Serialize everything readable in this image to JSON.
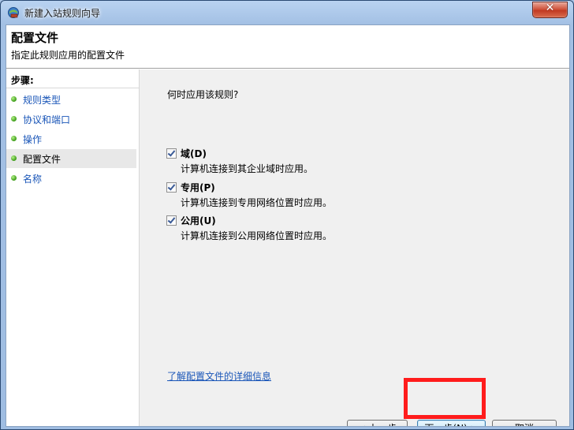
{
  "window": {
    "title": "新建入站规则向导",
    "close_symbol": "✕"
  },
  "header": {
    "title": "配置文件",
    "subtitle": "指定此规则应用的配置文件"
  },
  "sidebar": {
    "steps_label": "步骤:",
    "items": [
      {
        "label": "规则类型"
      },
      {
        "label": "协议和端口"
      },
      {
        "label": "操作"
      },
      {
        "label": "配置文件"
      },
      {
        "label": "名称"
      }
    ]
  },
  "content": {
    "question": "何时应用该规则?",
    "options": [
      {
        "label": "域(D)",
        "description": "计算机连接到其企业域时应用。",
        "checked": true
      },
      {
        "label": "专用(P)",
        "description": "计算机连接到专用网络位置时应用。",
        "checked": true
      },
      {
        "label": "公用(U)",
        "description": "计算机连接到公用网络位置时应用。",
        "checked": true
      }
    ],
    "learn_more_link": "了解配置文件的详细信息"
  },
  "buttons": {
    "back": "< 上一步(B)",
    "next": "下一步(N) >",
    "cancel": "取消"
  },
  "colors": {
    "highlight": "#ff1c1c",
    "link": "#1a56b8"
  }
}
